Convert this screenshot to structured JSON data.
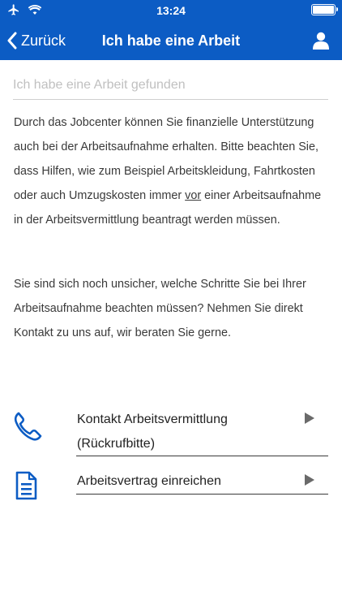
{
  "status_bar": {
    "time": "13:24"
  },
  "nav": {
    "back_label": "Zurück",
    "title": "Ich habe eine Arbeit"
  },
  "search": {
    "placeholder": "Ich habe eine Arbeit gefunden",
    "value": ""
  },
  "content": {
    "p1_before": "Durch das Jobcenter können Sie finanzielle Unterstützung auch bei der Arbeitsaufnahme erhalten. Bitte beachten Sie, dass Hilfen, wie zum Beispiel Arbeitskleidung, Fahrtkosten oder auch Umzugskosten immer ",
    "p1_underlined": "vor",
    "p1_after": " einer Arbeitsaufnahme in der Arbeitsvermittlung beantragt werden müssen.",
    "p2": "Sie sind sich noch unsicher, welche Schritte Sie bei Ihrer Arbeitsaufnahme beachten müssen? Nehmen Sie direkt Kontakt zu uns auf, wir beraten Sie gerne."
  },
  "actions": [
    {
      "label": "Kontakt Arbeitsvermittlung (Rückrufbitte)",
      "icon": "phone-icon"
    },
    {
      "label": "Arbeitsvertrag einreichen",
      "icon": "document-icon"
    }
  ],
  "colors": {
    "primary": "#0c5cc4",
    "text": "#3a3a3a",
    "placeholder": "#c0c0c0"
  }
}
